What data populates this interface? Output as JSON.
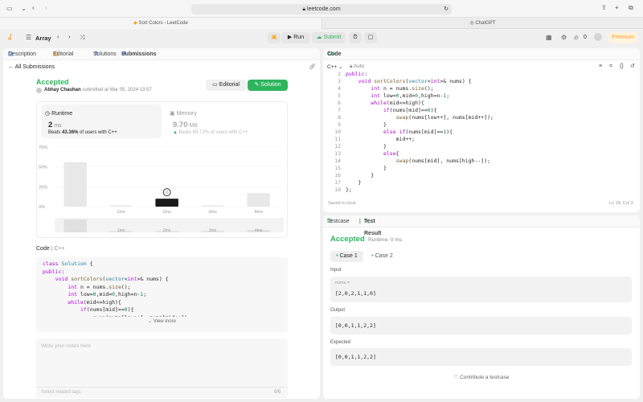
{
  "browser": {
    "url": "leetcode.com",
    "tabs": [
      {
        "title": "Sort Colors - LeetCode"
      },
      {
        "title": "ChatGPT"
      }
    ]
  },
  "nav": {
    "problem_list": "Array",
    "run_label": "Run",
    "submit_label": "Submit",
    "streak_count": "0",
    "premium_label": "Premium"
  },
  "left_tabs": [
    {
      "label": "Description"
    },
    {
      "label": "Editorial"
    },
    {
      "label": "Solutions"
    },
    {
      "label": "Submissions"
    }
  ],
  "submission": {
    "back_label": "All Submissions",
    "status": "Accepted",
    "author": "Abhay Chauhan",
    "submitted_text": "submitted at Mar 05, 2024 13:57",
    "editorial_button": "Editorial",
    "solution_button": "Solution",
    "runtime_label": "Runtime",
    "runtime_value": "2",
    "runtime_unit": "ms",
    "runtime_beats_prefix": "Beats",
    "runtime_beats_pct": "43.36%",
    "runtime_beats_suffix": "of users with C++",
    "memory_label": "Memory",
    "memory_value": "9.70",
    "memory_unit": "MB",
    "memory_beats_prefix": "Beats",
    "memory_beats_pct": "69.72%",
    "memory_beats_suffix": "of users with C++",
    "code_label": "Code",
    "code_lang": "C++",
    "view_more": "View more",
    "notes_placeholder": "Write your notes here",
    "tags_placeholder": "Select related tags",
    "tags_count": "0/5"
  },
  "chart_data": {
    "type": "bar",
    "yticks": [
      "75%",
      "50%",
      "25%",
      "0%"
    ],
    "xticks": [
      "1ms",
      "2ms",
      "3ms",
      "4ms"
    ],
    "ylim": [
      0,
      75
    ],
    "bars": [
      {
        "x": 0,
        "value": 56,
        "highlight": false
      },
      {
        "x": 1,
        "value": 1.5,
        "highlight": false
      },
      {
        "x": 2,
        "value": 10,
        "highlight": true
      },
      {
        "x": 3,
        "value": 1.5,
        "highlight": false
      },
      {
        "x": 4,
        "value": 17,
        "highlight": false
      }
    ],
    "mini_bars": [
      {
        "x": 0,
        "value": 16
      },
      {
        "x": 1,
        "value": 1.5
      },
      {
        "x": 2,
        "value": 1.5
      },
      {
        "x": 3,
        "value": 1.5
      },
      {
        "x": 4,
        "value": 3
      }
    ],
    "mini_xticks": [
      "1ms",
      "2ms",
      "3ms",
      "4ms"
    ]
  },
  "left_code": [
    "class Solution {",
    "public:",
    "    void sortColors(vector<int>& nums) {",
    "        int n = nums.size();",
    "        int low=0,mid=0,high=n-1;",
    "        while(mid<=high){",
    "            if(nums[mid]==0){",
    "                swap(nums[low++], nums[mid++]);"
  ],
  "editor": {
    "title": "Code",
    "lang": "C++",
    "mode": "Auto",
    "status_left": "Saved to local",
    "status_right": "Ln 18, Col 3",
    "lines": [
      {
        "n": "2",
        "t": "public:"
      },
      {
        "n": "3",
        "t": "    void sortColors(vector<int>& nums) {"
      },
      {
        "n": "4",
        "t": "        int n = nums.size();"
      },
      {
        "n": "5",
        "t": "        int low=0,mid=0,high=n-1;"
      },
      {
        "n": "6",
        "t": "        while(mid<=high){"
      },
      {
        "n": "7",
        "t": "            if(nums[mid]==0){"
      },
      {
        "n": "8",
        "t": "                swap(nums[low++], nums[mid++]);"
      },
      {
        "n": "9",
        "t": "            }"
      },
      {
        "n": "10",
        "t": "            else if(nums[mid]==1){"
      },
      {
        "n": "11",
        "t": "                mid++;"
      },
      {
        "n": "12",
        "t": "            }"
      },
      {
        "n": "13",
        "t": "            else{"
      },
      {
        "n": "14",
        "t": "                swap(nums[mid], nums[high--]);"
      },
      {
        "n": "15",
        "t": "            }"
      },
      {
        "n": "16",
        "t": "        }"
      },
      {
        "n": "17",
        "t": "    }"
      },
      {
        "n": "18",
        "t": "};"
      }
    ]
  },
  "result": {
    "testcase_tab": "Testcase",
    "result_tab": "Test Result",
    "status": "Accepted",
    "runtime_text": "Runtime: 0 ms",
    "cases": [
      {
        "label": "Case 1"
      },
      {
        "label": "Case 2"
      }
    ],
    "input_label": "Input",
    "var_name": "nums =",
    "input_value": "[2,0,2,1,1,0]",
    "output_label": "Output",
    "output_value": "[0,0,1,1,2,2]",
    "expected_label": "Expected",
    "expected_value": "[0,0,1,1,2,2]",
    "contribute": "Contribute a testcase"
  },
  "colors": {
    "accent_green": "#2db55d",
    "premium": "#ffa116",
    "highlight_bar": "#1a1a1a"
  }
}
